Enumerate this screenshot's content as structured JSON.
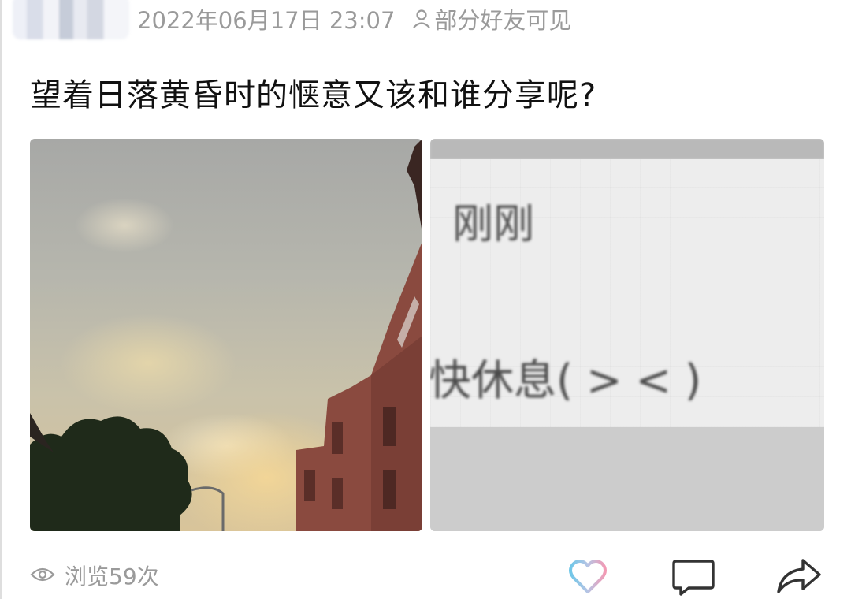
{
  "post": {
    "timestamp": "2022年06月17日 23:07",
    "visibility": "部分好友可见",
    "title": "望着日落黄昏时的惬意又该和谁分享呢?"
  },
  "images": [
    {
      "kind": "photo",
      "subject": "sunset sky with clouds, red brick building and tree"
    },
    {
      "kind": "screenshot",
      "line1": "刚刚",
      "line2": "快休息( > < )"
    }
  ],
  "footer": {
    "views": "浏览59次"
  },
  "icons": {
    "visibility": "person-icon",
    "views": "eye-icon",
    "like": "heart-icon",
    "comment": "comment-icon",
    "share": "share-icon"
  },
  "colors": {
    "meta_text": "#9a9a9a",
    "title_text": "#111111",
    "heart_left": "#6fc7e8",
    "heart_right": "#f29ab4"
  }
}
